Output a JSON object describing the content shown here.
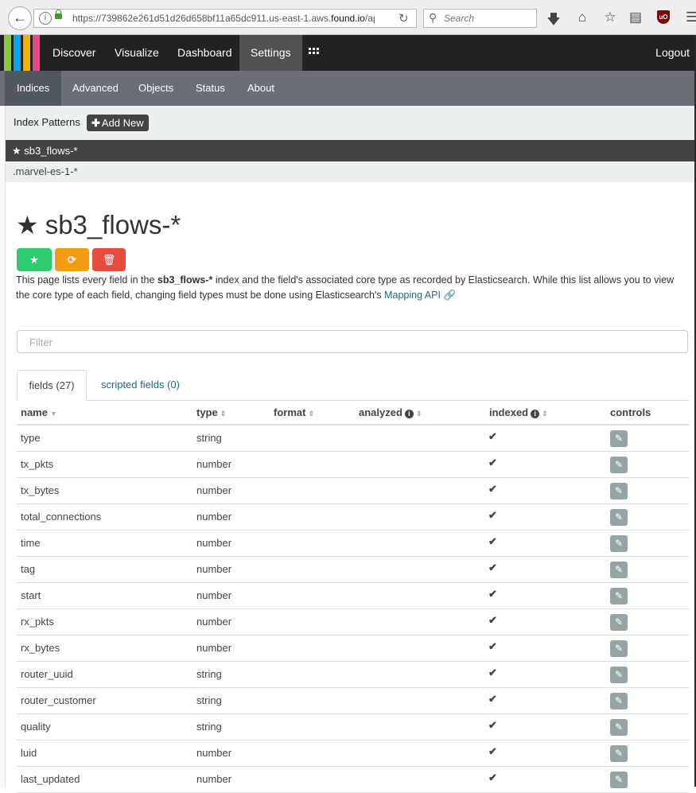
{
  "browser": {
    "url_prefix": "https://739862e261d51d26d658bf11a65dc911.us-east-1.aws.",
    "url_domain": "found.io",
    "url_suffix": "/ap",
    "search_placeholder": "Search"
  },
  "topnav": {
    "items": [
      "Discover",
      "Visualize",
      "Dashboard",
      "Settings"
    ],
    "active": "Settings",
    "logout": "Logout",
    "logo_colors": [
      "#8cc63f",
      "#00a9e5",
      "#f0b400",
      "#e8478b"
    ]
  },
  "subnav": {
    "items": [
      "Indices",
      "Advanced",
      "Objects",
      "Status",
      "About"
    ],
    "active": "Indices"
  },
  "index_patterns": {
    "title": "Index Patterns",
    "add_new": "Add New",
    "patterns": [
      {
        "name": "sb3_flows-*",
        "default": true
      },
      {
        "name": ".marvel-es-1-*",
        "default": false
      }
    ]
  },
  "main": {
    "title": "sb3_flows-*",
    "buttons": [
      {
        "icon": "star-icon",
        "color": "#2ecc71"
      },
      {
        "icon": "refresh-icon",
        "color": "#f39c12"
      },
      {
        "icon": "trash-icon",
        "color": "#e74c3c"
      }
    ],
    "desc_part1": "This page lists every field in the ",
    "desc_index": "sb3_flows-*",
    "desc_part2": " index and the field's associated core type as recorded by Elasticsearch. While this list allows you to view the core type of each field, changing field types must be done using Elasticsearch's ",
    "desc_link": "Mapping API",
    "filter_placeholder": "Filter",
    "tabs": [
      "fields (27)",
      "scripted fields (0)"
    ],
    "columns": [
      "name",
      "type",
      "format",
      "analyzed",
      "indexed",
      "controls"
    ],
    "fields": [
      {
        "name": "type",
        "type": "string",
        "indexed": true
      },
      {
        "name": "tx_pkts",
        "type": "number",
        "indexed": true
      },
      {
        "name": "tx_bytes",
        "type": "number",
        "indexed": true
      },
      {
        "name": "total_connections",
        "type": "number",
        "indexed": true
      },
      {
        "name": "time",
        "type": "number",
        "indexed": true
      },
      {
        "name": "tag",
        "type": "number",
        "indexed": true
      },
      {
        "name": "start",
        "type": "number",
        "indexed": true
      },
      {
        "name": "rx_pkts",
        "type": "number",
        "indexed": true
      },
      {
        "name": "rx_bytes",
        "type": "number",
        "indexed": true
      },
      {
        "name": "router_uuid",
        "type": "string",
        "indexed": true
      },
      {
        "name": "router_customer",
        "type": "string",
        "indexed": true
      },
      {
        "name": "quality",
        "type": "string",
        "indexed": true
      },
      {
        "name": "luid",
        "type": "number",
        "indexed": true
      },
      {
        "name": "last_updated",
        "type": "number",
        "indexed": true
      }
    ]
  }
}
